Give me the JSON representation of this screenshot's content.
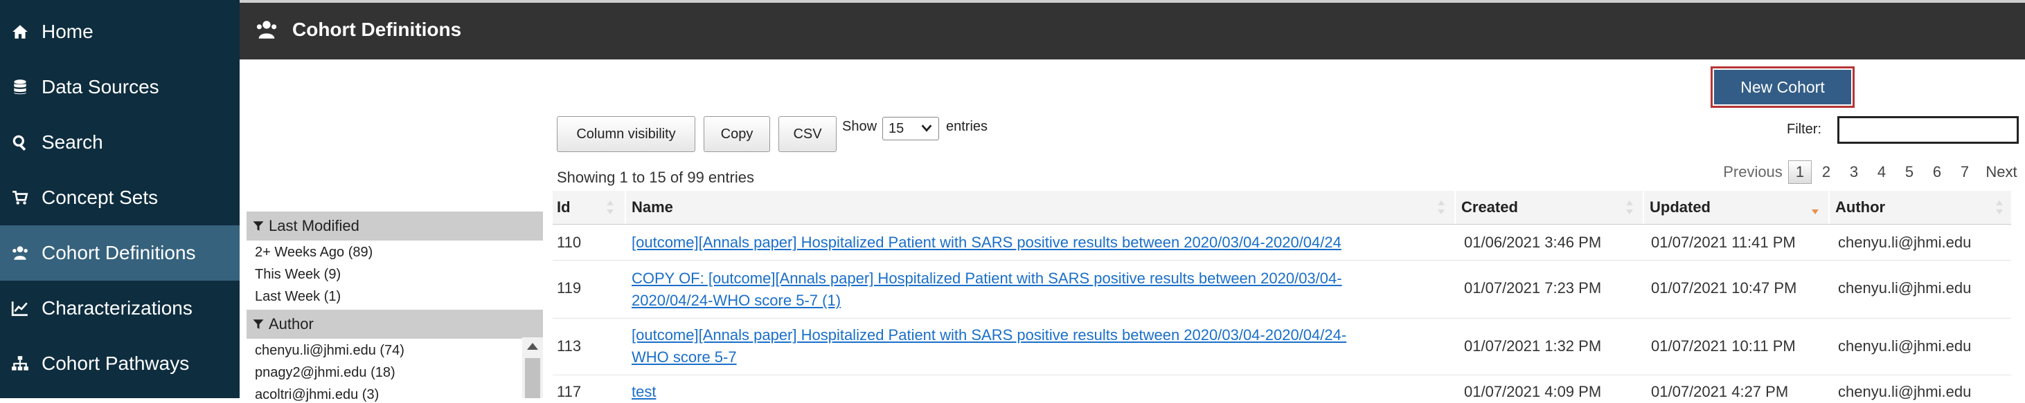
{
  "sidebar": {
    "items": [
      {
        "label": "Home",
        "icon": "home-icon"
      },
      {
        "label": "Data Sources",
        "icon": "database-icon"
      },
      {
        "label": "Search",
        "icon": "search-icon"
      },
      {
        "label": "Concept Sets",
        "icon": "cart-icon"
      },
      {
        "label": "Cohort Definitions",
        "icon": "users-icon",
        "active": true
      },
      {
        "label": "Characterizations",
        "icon": "chart-line-icon"
      },
      {
        "label": "Cohort Pathways",
        "icon": "sitemap-icon"
      }
    ]
  },
  "header": {
    "title": "Cohort Definitions",
    "icon": "users-icon"
  },
  "toolbar": {
    "new_cohort": "New Cohort",
    "column_visibility": "Column visibility",
    "copy": "Copy",
    "csv": "CSV",
    "show": "Show",
    "entries_value": "15",
    "entries": "entries",
    "filter": "Filter:",
    "filter_value": ""
  },
  "info": "Showing 1 to 15 of 99 entries",
  "pagination": {
    "previous": "Previous",
    "pages": [
      "1",
      "2",
      "3",
      "4",
      "5",
      "6",
      "7"
    ],
    "current": "1",
    "next": "Next"
  },
  "facets": {
    "last_modified": {
      "title": "Last Modified",
      "items": [
        "2+ Weeks Ago (89)",
        "This Week (9)",
        "Last Week (1)"
      ]
    },
    "author": {
      "title": "Author",
      "items": [
        "chenyu.li@jhmi.edu (74)",
        "pnagy2@jhmi.edu (18)",
        "acoltri@jhmi.edu (3)"
      ]
    }
  },
  "table": {
    "columns": [
      "Id",
      "Name",
      "Created",
      "Updated",
      "Author"
    ],
    "rows": [
      {
        "id": "110",
        "name_lines": [
          "[outcome][Annals paper] Hospitalized Patient with SARS positive results between 2020/03/04-2020/04/24"
        ],
        "created": "01/06/2021 3:46 PM",
        "updated": "01/07/2021 11:41 PM",
        "author": "chenyu.li@jhmi.edu"
      },
      {
        "id": "119",
        "name_lines": [
          "COPY OF: [outcome][Annals paper] Hospitalized Patient with SARS positive results between 2020/03/04-",
          "2020/04/24-WHO score 5-7 (1)"
        ],
        "created": "01/07/2021 7:23 PM",
        "updated": "01/07/2021 10:47 PM",
        "author": "chenyu.li@jhmi.edu"
      },
      {
        "id": "113",
        "name_lines": [
          "[outcome][Annals paper] Hospitalized Patient with SARS positive results between 2020/03/04-2020/04/24-",
          "WHO score 5-7"
        ],
        "created": "01/07/2021 1:32 PM",
        "updated": "01/07/2021 10:11 PM",
        "author": "chenyu.li@jhmi.edu"
      },
      {
        "id": "117",
        "name_lines": [
          "test"
        ],
        "created": "01/07/2021 4:09 PM",
        "updated": "01/07/2021 4:27 PM",
        "author": "chenyu.li@jhmi.edu"
      }
    ]
  },
  "colors": {
    "sidebar": "#0e2d3f",
    "sidebar_active": "#36627d",
    "header": "#333333",
    "primary_button": "#335d86",
    "link": "#1a6fc9"
  }
}
